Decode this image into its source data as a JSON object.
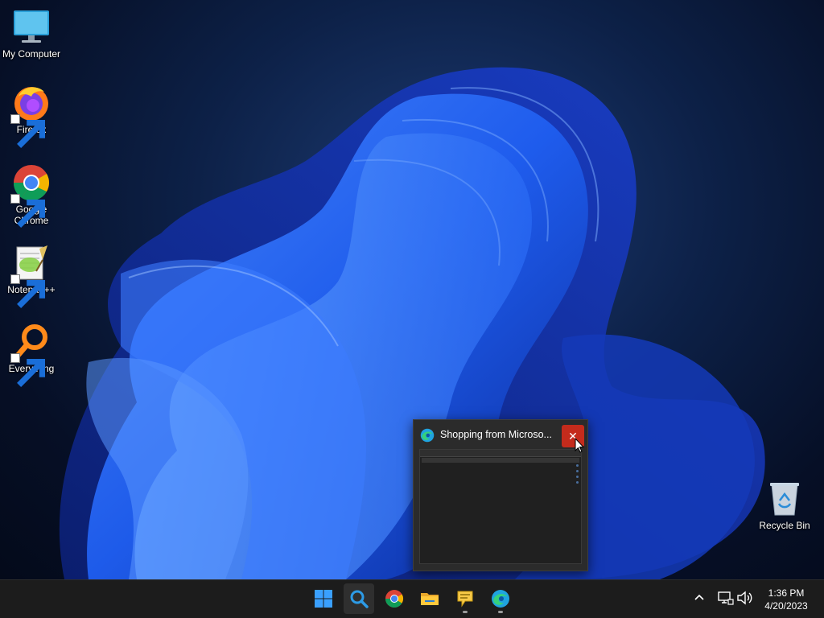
{
  "desktop": {
    "icons": [
      {
        "label": "My Computer",
        "icon": "monitor-icon"
      },
      {
        "label": "Firefox",
        "icon": "firefox-icon"
      },
      {
        "label": "Google\nChrome",
        "icon": "chrome-icon"
      },
      {
        "label": "Notepad++",
        "icon": "notepadpp-icon"
      },
      {
        "label": "Everything",
        "icon": "everything-search-icon"
      },
      {
        "label": "Recycle Bin",
        "icon": "recycle-bin-icon"
      }
    ]
  },
  "preview": {
    "title": "Shopping from Microso...",
    "close_symbol": "✕",
    "app_icon": "edge-icon"
  },
  "taskbar": {
    "items": [
      {
        "name": "Start",
        "icon": "windows-start-icon"
      },
      {
        "name": "Everything",
        "icon": "everything-search-icon",
        "active": true
      },
      {
        "name": "Google Chrome",
        "icon": "chrome-icon"
      },
      {
        "name": "File Explorer",
        "icon": "folder-icon"
      },
      {
        "name": "Chat",
        "icon": "chat-bubble-icon",
        "running": true
      },
      {
        "name": "Microsoft Edge",
        "icon": "edge-icon",
        "running": true
      }
    ],
    "tray": {
      "chevron": "^",
      "icons": [
        "network-icon",
        "volume-icon"
      ]
    },
    "clock": {
      "time": "1:36 PM",
      "date": "4/20/2023"
    }
  },
  "colors": {
    "accent": "#0067c0",
    "taskbar": "#1c1c1c",
    "close": "#c42b1c"
  }
}
